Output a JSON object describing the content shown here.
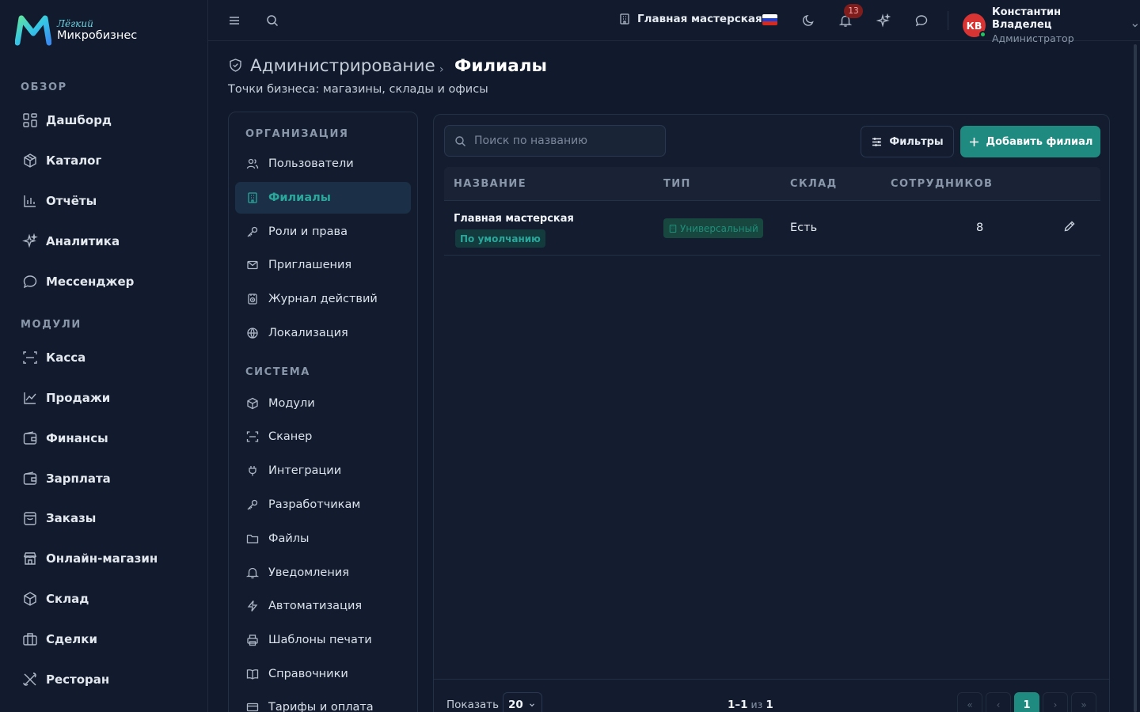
{
  "brand": {
    "line1": "Лёгкий",
    "line2": "Микробизнес"
  },
  "sidebar": {
    "sections": [
      {
        "title": "ОБЗОР",
        "items": [
          {
            "label": "Дашборд",
            "icon": "dashboard-icon"
          },
          {
            "label": "Каталог",
            "icon": "catalog-icon"
          },
          {
            "label": "Отчёты",
            "icon": "reports-icon"
          },
          {
            "label": "Аналитика",
            "icon": "sparkles-icon"
          },
          {
            "label": "Мессенджер",
            "icon": "chat-icon"
          }
        ]
      },
      {
        "title": "МОДУЛИ",
        "items": [
          {
            "label": "Касса",
            "icon": "scan-icon"
          },
          {
            "label": "Продажи",
            "icon": "sales-chart-icon"
          },
          {
            "label": "Финансы",
            "icon": "wallet-icon"
          },
          {
            "label": "Зарплата",
            "icon": "wallet-icon"
          },
          {
            "label": "Заказы",
            "icon": "clipboard-icon"
          },
          {
            "label": "Онлайн-магазин",
            "icon": "store-icon"
          },
          {
            "label": "Склад",
            "icon": "box-icon"
          },
          {
            "label": "Сделки",
            "icon": "briefcase-icon"
          },
          {
            "label": "Ресторан",
            "icon": "utensils-icon"
          }
        ]
      }
    ]
  },
  "header": {
    "branch": "Главная мастерская",
    "notifications_count": "13",
    "flag_colors": [
      "#ffffff",
      "#1c3fd6",
      "#d52b1e"
    ],
    "user": {
      "initials": "КВ",
      "name": "Константин Владелец",
      "role": "Администратор"
    }
  },
  "page": {
    "breadcrumb_root": "Администрирование",
    "breadcrumb_separator": "›",
    "title": "Филиалы",
    "subtitle": "Точки бизнеса: магазины, склады и офисы"
  },
  "admin_nav": {
    "sections": [
      {
        "title": "ОРГАНИЗАЦИЯ",
        "items": [
          {
            "label": "Пользователи",
            "icon": "users-icon",
            "active": false
          },
          {
            "label": "Филиалы",
            "icon": "building-icon",
            "active": true
          },
          {
            "label": "Роли и права",
            "icon": "key-icon",
            "active": false
          },
          {
            "label": "Приглашения",
            "icon": "mail-icon",
            "active": false
          },
          {
            "label": "Журнал действий",
            "icon": "history-icon",
            "active": false
          },
          {
            "label": "Локализация",
            "icon": "globe-icon",
            "active": false
          }
        ]
      },
      {
        "title": "СИСТЕМА",
        "items": [
          {
            "label": "Модули",
            "icon": "box-icon",
            "active": false
          },
          {
            "label": "Сканер",
            "icon": "scan-icon",
            "active": false
          },
          {
            "label": "Интеграции",
            "icon": "plug-icon",
            "active": false
          },
          {
            "label": "Разработчикам",
            "icon": "key-icon",
            "active": false
          },
          {
            "label": "Файлы",
            "icon": "folder-icon",
            "active": false
          },
          {
            "label": "Уведомления",
            "icon": "bell-icon",
            "active": false
          },
          {
            "label": "Автоматизация",
            "icon": "zap-icon",
            "active": false
          },
          {
            "label": "Шаблоны печати",
            "icon": "printer-icon",
            "active": false
          },
          {
            "label": "Справочники",
            "icon": "book-icon",
            "active": false
          },
          {
            "label": "Тарифы и оплата",
            "icon": "card-icon",
            "active": false
          }
        ]
      }
    ]
  },
  "toolbar": {
    "search_placeholder": "Поиск по названию",
    "filters_label": "Фильтры",
    "add_label": "Добавить филиал"
  },
  "table": {
    "columns": [
      "НАЗВАНИЕ",
      "ТИП",
      "СКЛАД",
      "СОТРУДНИКОВ"
    ],
    "rows": [
      {
        "name": "Главная мастерская",
        "default_badge": "По умолчанию",
        "type": "Универсальный",
        "warehouse": "Есть",
        "employees": "8"
      }
    ]
  },
  "pagination": {
    "show_label": "Показать",
    "per_page": "20",
    "range_from_to": "1–1",
    "range_of": "из",
    "range_total": "1",
    "current_page": "1"
  },
  "colors": {
    "accent": "#1f8a80",
    "accent_text": "#2aa79a",
    "bg": "#111a2c",
    "badge_bg": "#7f1d1d"
  }
}
